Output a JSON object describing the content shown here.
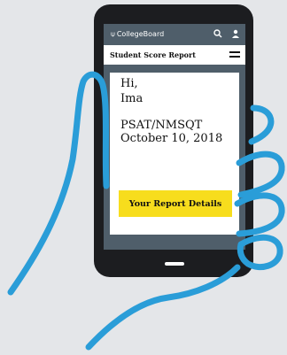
{
  "header": {
    "brand": "CollegeBoard",
    "brand_icon": "acorn-logo-icon",
    "icons": [
      "search-icon",
      "user-icon"
    ]
  },
  "nav": {
    "title": "Student Score Report",
    "menu_icon": "hamburger-menu-icon"
  },
  "report": {
    "greeting": "Hi,",
    "name": "Ima",
    "test": "PSAT/NMSQT",
    "date": "October 10, 2018",
    "cta_label": "Your Report Details"
  },
  "colors": {
    "background": "#e4e6e9",
    "phone": "#1c1d20",
    "screen": "#4f5e6a",
    "cta": "#f7dd1d",
    "hand_outline": "#2a9dd8"
  }
}
